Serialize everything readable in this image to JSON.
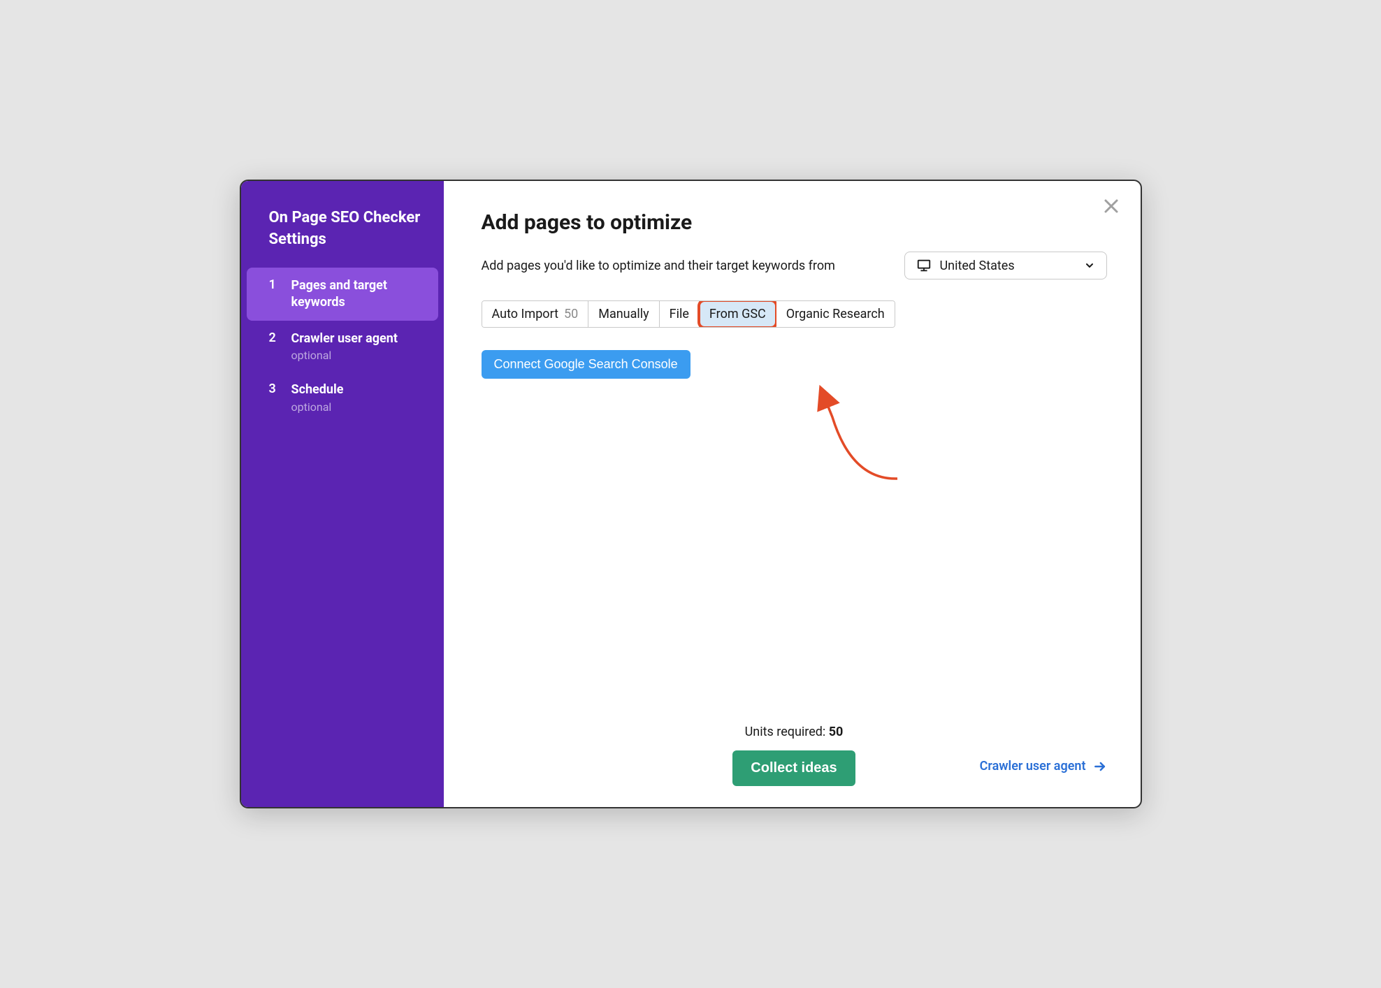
{
  "sidebar": {
    "title": "On Page SEO Checker Settings",
    "steps": [
      {
        "number": "1",
        "label": "Pages and target keywords",
        "optional": ""
      },
      {
        "number": "2",
        "label": "Crawler user agent",
        "optional": "optional"
      },
      {
        "number": "3",
        "label": "Schedule",
        "optional": "optional"
      }
    ]
  },
  "main": {
    "title": "Add pages to optimize",
    "intro": "Add pages you'd like to optimize and their target keywords from",
    "country": "United States",
    "tabs": {
      "auto_import": "Auto Import",
      "auto_import_count": "50",
      "manually": "Manually",
      "file": "File",
      "from_gsc": "From GSC",
      "organic_research": "Organic Research"
    },
    "connect_button": "Connect Google Search Console",
    "footer": {
      "units_label": "Units required: ",
      "units_value": "50",
      "collect_button": "Collect ideas",
      "crawler_link": "Crawler user agent"
    }
  }
}
